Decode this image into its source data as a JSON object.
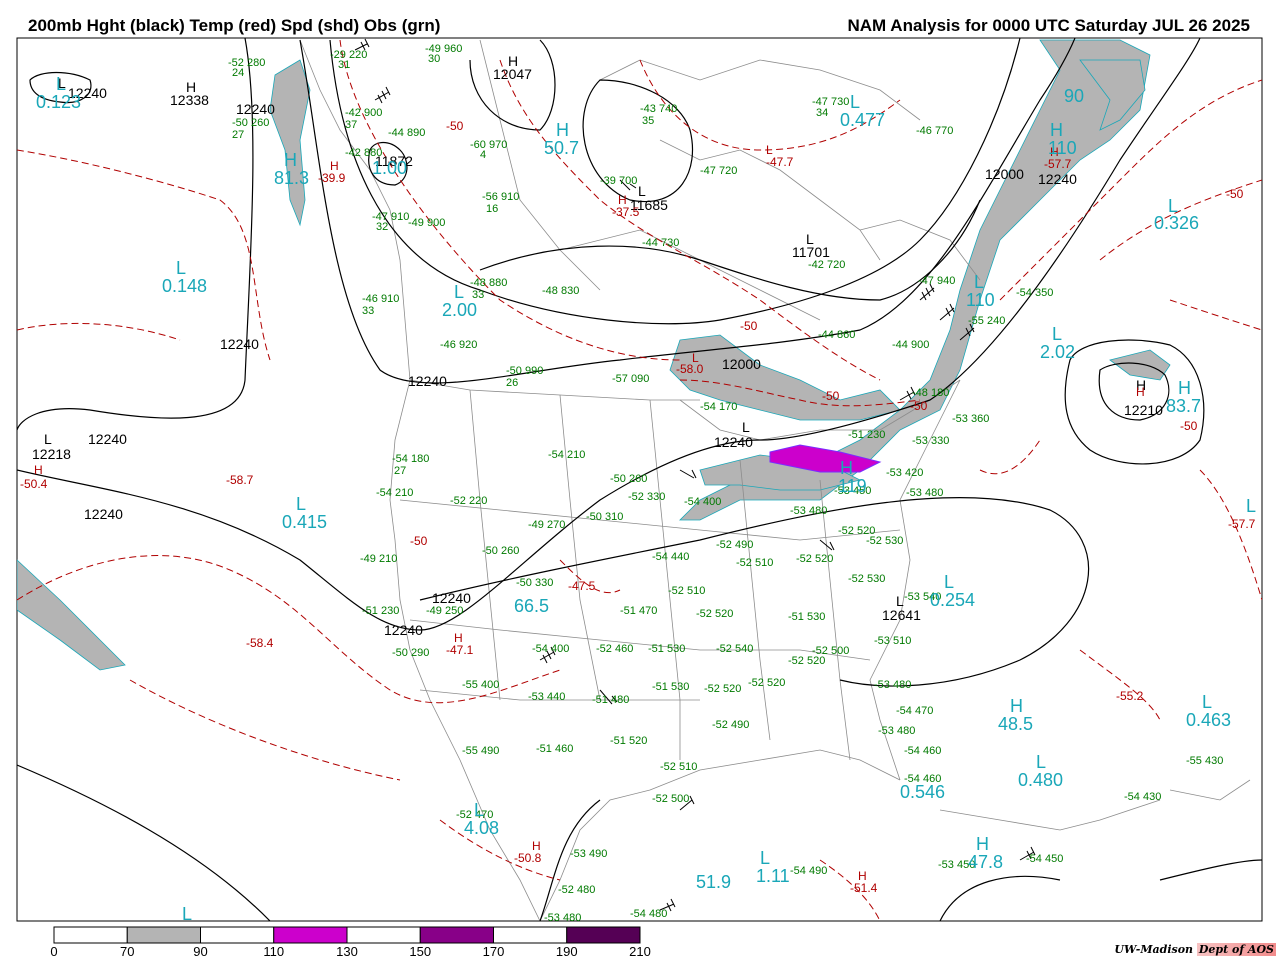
{
  "header": {
    "left_title": "200mb Hght (black) Temp (red) Spd (shd) Obs (grn)",
    "right_title": "NAM Analysis for 0000 UTC Saturday  JUL 26 2025"
  },
  "credit": {
    "org": "UW-Madison",
    "dept": "Dept of AOS"
  },
  "colors": {
    "height": "#000000",
    "temp": "#b00000",
    "speed_label": "#1aa7b8",
    "obs": "#007a00",
    "shade_70": "#b4b4b4",
    "shade_110": "#cc00cc",
    "shade_150": "#880088",
    "shade_190": "#550055",
    "border": "#8c8c8c"
  },
  "legend": {
    "ticks": [
      "0",
      "70",
      "90",
      "110",
      "130",
      "150",
      "170",
      "190",
      "210"
    ],
    "bins": [
      {
        "from": 0,
        "to": 70,
        "color": "#ffffff"
      },
      {
        "from": 70,
        "to": 90,
        "color": "#b4b4b4"
      },
      {
        "from": 90,
        "to": 110,
        "color": "#ffffff"
      },
      {
        "from": 110,
        "to": 130,
        "color": "#cc00cc"
      },
      {
        "from": 130,
        "to": 150,
        "color": "#ffffff"
      },
      {
        "from": 150,
        "to": 170,
        "color": "#880088"
      },
      {
        "from": 170,
        "to": 190,
        "color": "#ffffff"
      },
      {
        "from": 190,
        "to": 210,
        "color": "#550055"
      }
    ]
  },
  "height_labels": [
    "12240",
    "12338",
    "12240",
    "12047",
    "11872",
    "11685",
    "11701",
    "12000",
    "12240",
    "12240",
    "12240",
    "12240",
    "12218",
    "12240",
    "12000",
    "12240",
    "12210",
    "12641"
  ],
  "height_centers": [
    "L",
    "H",
    "H",
    "H",
    "L",
    "L",
    "L",
    "L",
    "L",
    "H"
  ],
  "temp_labels": [
    "-39.9",
    "-37.5",
    "-47.7",
    "-57.7",
    "-50",
    "-58.0",
    "-50",
    "-50",
    "-58.7",
    "-50.4",
    "-50",
    "-47.5",
    "-47.1",
    "-58.4",
    "-50.8",
    "-51.4",
    "-55.2",
    "-57.7",
    "-50"
  ],
  "temp_centers": [
    "H",
    "H",
    "L",
    "H",
    "H",
    "H",
    "H",
    "H",
    "L",
    "H"
  ],
  "speed_labels": [
    "0.123",
    "81.3",
    "1.00",
    "50.7",
    "0.477",
    "110",
    "0.148",
    "2.00",
    "110",
    "2.02",
    "83.7",
    "0.326",
    "90",
    "0.415",
    "119",
    "66.5",
    "0.254",
    "48.5",
    "0.463",
    "0.480",
    "0.546",
    "4.08",
    "51.9",
    "1.11",
    "47.8"
  ],
  "speed_centers": [
    "L",
    "H",
    "H",
    "L",
    "L",
    "L",
    "L",
    "H",
    "L",
    "L",
    "H",
    "L",
    "L",
    "H",
    "L",
    "L",
    "L",
    "L",
    "H",
    "L",
    "L",
    "H"
  ],
  "obs": [
    "-52 280",
    "24",
    "-29 220",
    "31",
    "-49 960",
    "30",
    "-42 900",
    "37",
    "-44 890",
    "-50 260",
    "27",
    "-42 880",
    "-60 970",
    "4",
    "-43 740",
    "35",
    "-47 730",
    "34",
    "-46 770",
    "-47 720",
    "-39 700",
    "-56 910",
    "16",
    "-47 910",
    "32",
    "-49 900",
    "-44 730",
    "-42 720",
    "-47 940",
    "-48 880",
    "33",
    "-48 830",
    "-46 910",
    "33",
    "-46 920",
    "-44 860",
    "-44 900",
    "-55 240",
    "-54 350",
    "-50 990",
    "26",
    "-57 090",
    "-54 170",
    "-51 230",
    "-53 330",
    "-48 180",
    "-53 360",
    "-54 180",
    "27",
    "-54 210",
    "-54 210",
    "-52 220",
    "-50 260",
    "-52 330",
    "-54 400",
    "-53 420",
    "-53 450",
    "-53 480",
    "-53 480",
    "-50 260",
    "-49 270",
    "-50 310",
    "-52 520",
    "-52 530",
    "-49 210",
    "-49 250",
    "-50 330",
    "-54 440",
    "-52 490",
    "-52 510",
    "-52 520",
    "-52 530",
    "-51 230",
    "-51 470",
    "-52 510",
    "-52 520",
    "-51 530",
    "-53 540",
    "-53 510",
    "-50 290",
    "-54 400",
    "-52 460",
    "-51 530",
    "-52 540",
    "-52 520",
    "-52 500",
    "-53 480",
    "-55 400",
    "-53 440",
    "-51 480",
    "-51 530",
    "-52 520",
    "-52 520",
    "-54 470",
    "-53 480",
    "-55 490",
    "-51 460",
    "-51 520",
    "-52 490",
    "-54 460",
    "-52 510",
    "-54 460",
    "-55 430",
    "-52 470",
    "-52 500",
    "-54 430",
    "-53 490",
    "-54 490",
    "-52 480",
    "-53 450",
    "-54 450",
    "-53 480",
    "-54 480"
  ]
}
